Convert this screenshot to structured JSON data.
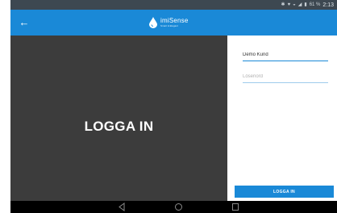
{
  "status_bar": {
    "icons": [
      "bluetooth-icon",
      "location-icon",
      "wifi-icon",
      "signal-icon",
      "battery-icon"
    ],
    "battery": "61 %",
    "time": "2:13"
  },
  "app_bar": {
    "back_icon": "arrow-left-icon",
    "logo_name": "imiSense",
    "logo_tagline": "Smart & Elegant",
    "color": "#1a89d7"
  },
  "hero": {
    "title": "LOGGA IN",
    "background": "#3c3c3c"
  },
  "login_form": {
    "username_value": "Demo Kund",
    "password_placeholder": "Lösenord",
    "submit_label": "LOGGA IN"
  },
  "nav_bar": {
    "icons": [
      "nav-back-icon",
      "nav-home-icon",
      "nav-recents-icon"
    ]
  }
}
